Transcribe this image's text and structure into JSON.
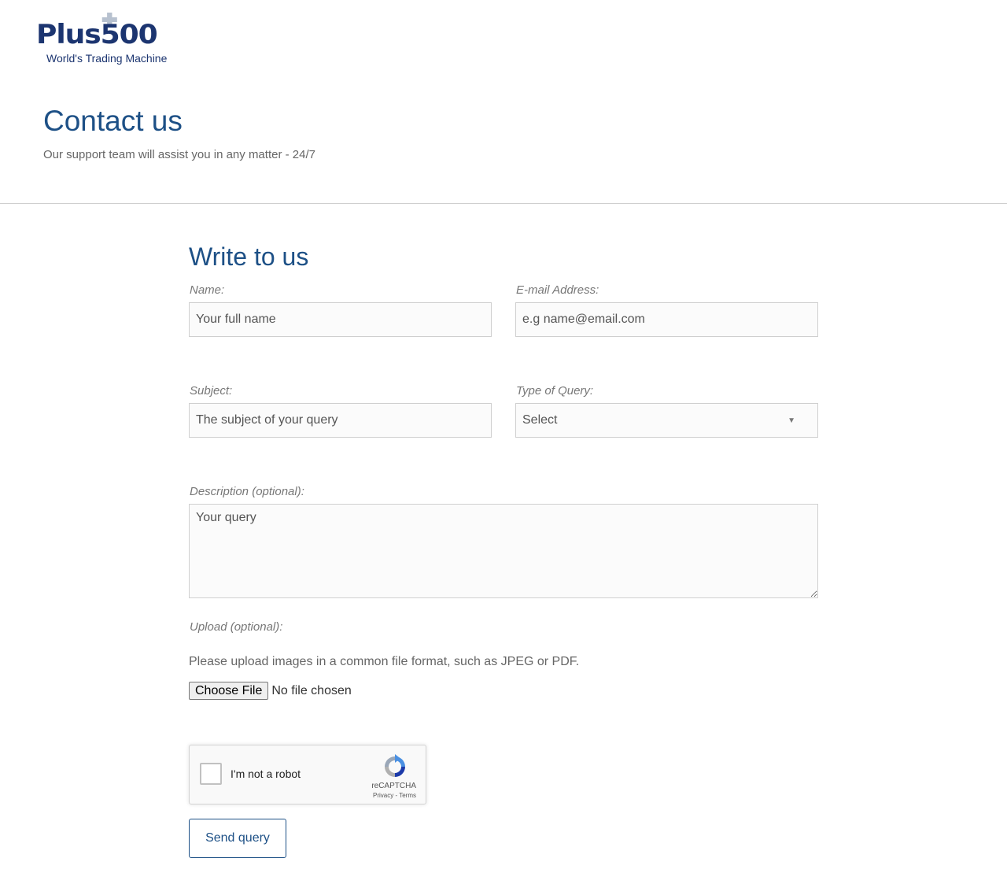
{
  "brand": {
    "logo_text": "Plus500",
    "tagline": "World's Trading Machine"
  },
  "header": {
    "title": "Contact us",
    "subtitle": "Our support team will assist you in any matter - 24/7"
  },
  "form": {
    "title": "Write to us",
    "name": {
      "label": "Name:",
      "placeholder": "Your full name"
    },
    "email": {
      "label": "E-mail Address:",
      "placeholder": "e.g name@email.com"
    },
    "subject": {
      "label": "Subject:",
      "placeholder": "The subject of your query"
    },
    "query_type": {
      "label": "Type of Query:",
      "value": "Select"
    },
    "description": {
      "label": "Description (optional):",
      "placeholder": "Your query"
    },
    "upload": {
      "label": "Upload (optional):",
      "note": "Please upload images in a common file format, such as JPEG or PDF.",
      "button": "Choose File",
      "status": "No file chosen"
    },
    "captcha": {
      "label": "I'm not a robot",
      "brand": "reCAPTCHA",
      "links": "Privacy - Terms"
    },
    "submit_label": "Send query"
  },
  "colors": {
    "brand_navy": "#1c3570",
    "heading_blue": "#1d5086",
    "logo_cross": "#b7c1cf"
  },
  "icons": [
    "plus-cross-icon",
    "chevron-down-icon",
    "recaptcha-icon"
  ]
}
